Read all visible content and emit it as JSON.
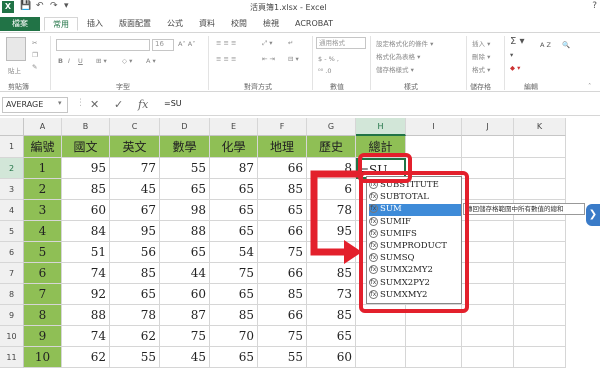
{
  "window": {
    "title": "活頁簿1.xlsx - Excel",
    "app_logo": "X",
    "help": "?"
  },
  "qat": {
    "save": "💾",
    "undo": "↶",
    "redo": "↷",
    "more": "▾"
  },
  "tabs": [
    "檔案",
    "常用",
    "插入",
    "版面配置",
    "公式",
    "資料",
    "校閱",
    "檢視",
    "ACROBAT"
  ],
  "active_tab": "常用",
  "ribbon": {
    "groups": [
      "剪貼簿",
      "字型",
      "對齊方式",
      "數值",
      "樣式",
      "儲存格",
      "編輯"
    ],
    "paste_label": "貼上",
    "font_size": "16",
    "number_format": "通用格式",
    "percent_row": "$ - % ,",
    "styles": [
      "設定格式化的條件 ▾",
      "格式化為表格 ▾",
      "儲存格樣式 ▾"
    ],
    "cells": [
      "插入 ▾",
      "刪除 ▾",
      "格式 ▾"
    ],
    "edit_sym": [
      "Σ ▾",
      "▾",
      "◆ ▾"
    ],
    "sort_label": "A Z"
  },
  "formula_bar": {
    "name_box": "AVERAGE",
    "cancel": "✕",
    "enter": "✓",
    "fx": "fx",
    "formula": "=SU"
  },
  "columns": [
    "A",
    "B",
    "C",
    "D",
    "E",
    "F",
    "G",
    "H",
    "I",
    "J",
    "K"
  ],
  "active_column": "H",
  "row_numbers": [
    "1",
    "2",
    "3",
    "4",
    "5",
    "6",
    "7",
    "8",
    "9",
    "10",
    "11"
  ],
  "active_row": "2",
  "table": {
    "headers": [
      "編號",
      "國文",
      "英文",
      "數學",
      "化學",
      "地理",
      "歷史",
      "總計"
    ],
    "rows": [
      [
        "1",
        "95",
        "77",
        "55",
        "87",
        "66",
        "8"
      ],
      [
        "2",
        "85",
        "45",
        "65",
        "65",
        "85",
        "6"
      ],
      [
        "3",
        "60",
        "67",
        "98",
        "65",
        "65",
        "78"
      ],
      [
        "4",
        "84",
        "95",
        "88",
        "65",
        "66",
        "95"
      ],
      [
        "5",
        "51",
        "56",
        "65",
        "54",
        "75",
        "8"
      ],
      [
        "6",
        "74",
        "85",
        "44",
        "75",
        "66",
        "85"
      ],
      [
        "7",
        "92",
        "65",
        "60",
        "65",
        "85",
        "73"
      ],
      [
        "8",
        "88",
        "78",
        "87",
        "85",
        "66",
        "85"
      ],
      [
        "9",
        "74",
        "62",
        "75",
        "70",
        "75",
        "65"
      ],
      [
        "10",
        "62",
        "55",
        "45",
        "65",
        "55",
        "60"
      ]
    ],
    "active_cell_value": "=SU"
  },
  "autocomplete": {
    "items": [
      "SUBSTITUTE",
      "SUBTOTAL",
      "SUM",
      "SUMIF",
      "SUMIFS",
      "SUMPRODUCT",
      "SUMSQ",
      "SUMX2MY2",
      "SUMX2PY2",
      "SUMXMY2"
    ],
    "selected": "SUM",
    "tooltip": "傳回儲存格範圍中所有數值的總和",
    "fn_icon": "fx"
  },
  "side_button": "❯",
  "colors": {
    "accent": "#217346",
    "header_fill": "#8fbf55",
    "highlight": "#e3202c",
    "selection": "#3e8bd8"
  }
}
